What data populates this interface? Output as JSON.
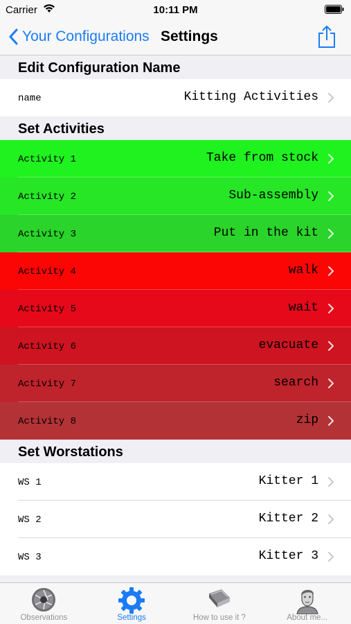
{
  "status_bar": {
    "carrier": "Carrier",
    "time": "10:11 PM"
  },
  "nav": {
    "back_label": "Your Configurations",
    "title": "Settings"
  },
  "sections": {
    "config_name": {
      "header": "Edit Configuration Name",
      "row": {
        "label": "name",
        "value": "Kitting Activities"
      }
    },
    "activities": {
      "header": "Set Activities",
      "rows": [
        {
          "label": "Activity 1",
          "value": "Take from stock",
          "color": "#1ff21f"
        },
        {
          "label": "Activity 2",
          "value": "Sub-assembly",
          "color": "#26e626"
        },
        {
          "label": "Activity 3",
          "value": "Put in the kit",
          "color": "#2ad42a"
        },
        {
          "label": "Activity 4",
          "value": "walk",
          "color": "#fb0505"
        },
        {
          "label": "Activity 5",
          "value": "wait",
          "color": "#e5091a"
        },
        {
          "label": "Activity 6",
          "value": "evacuate",
          "color": "#ce1421"
        },
        {
          "label": "Activity 7",
          "value": "search",
          "color": "#bf232b"
        },
        {
          "label": "Activity 8",
          "value": "zip",
          "color": "#b33236"
        }
      ]
    },
    "workstations": {
      "header": "Set Worstations",
      "rows": [
        {
          "label": "WS 1",
          "value": "Kitter 1"
        },
        {
          "label": "WS 2",
          "value": "Kitter 2"
        },
        {
          "label": "WS 3",
          "value": "Kitter 3"
        }
      ]
    }
  },
  "tab_bar": {
    "tabs": [
      {
        "label": "Observations",
        "icon": "aperture-icon",
        "active": false
      },
      {
        "label": "Settings",
        "icon": "gear-icon",
        "active": true
      },
      {
        "label": "How to use it ?",
        "icon": "book-icon",
        "active": false
      },
      {
        "label": "About me...",
        "icon": "portrait-icon",
        "active": false
      }
    ]
  },
  "colors": {
    "accent": "#1a7cf5",
    "inactive_tab": "#929292",
    "background": "#efeff4"
  }
}
